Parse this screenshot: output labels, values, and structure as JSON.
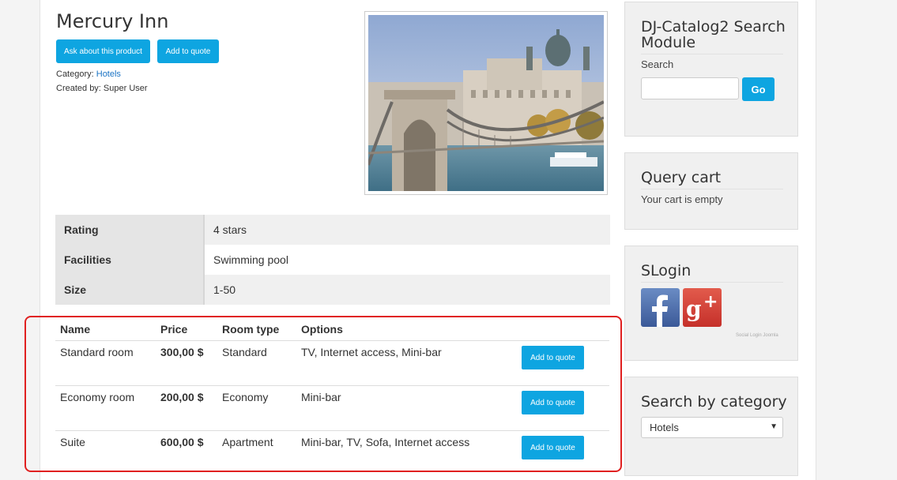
{
  "product": {
    "title": "Mercury Inn",
    "ask_button": "Ask about this product",
    "add_quote_button": "Add to quote",
    "category_label": "Category: ",
    "category_value": "Hotels",
    "created_by": "Created by: Super User",
    "image_icon": "city-bridge-photo"
  },
  "attributes": [
    {
      "name": "Rating",
      "value": "4 stars"
    },
    {
      "name": "Facilities",
      "value": "Swimming pool"
    },
    {
      "name": "Size",
      "value": "1-50"
    }
  ],
  "rooms": {
    "headers": {
      "name": "Name",
      "price": "Price",
      "type": "Room type",
      "options": "Options"
    },
    "rows": [
      {
        "name": "Standard room",
        "price": "300,00 $",
        "type": "Standard",
        "options": "TV, Internet access, Mini-bar",
        "button": "Add to quote"
      },
      {
        "name": "Economy room",
        "price": "200,00 $",
        "type": "Economy",
        "options": "Mini-bar",
        "button": "Add to quote"
      },
      {
        "name": "Suite",
        "price": "600,00 $",
        "type": "Apartment",
        "options": "Mini-bar, TV, Sofa, Internet access",
        "button": "Add to quote"
      }
    ]
  },
  "sidebar": {
    "search": {
      "title": "DJ-Catalog2 Search Module",
      "label": "Search",
      "input_value": "",
      "go_button": "Go"
    },
    "cart": {
      "title": "Query cart",
      "text": "Your cart is empty"
    },
    "slogin": {
      "title": "SLogin",
      "credit": "Social Login Joomla",
      "icons": [
        "facebook-icon",
        "google-plus-icon"
      ]
    },
    "category": {
      "title": "Search by category",
      "selected": "Hotels"
    }
  },
  "colors": {
    "accent": "#0ea5e1",
    "highlight": "#e02020",
    "link": "#1a73c4"
  }
}
